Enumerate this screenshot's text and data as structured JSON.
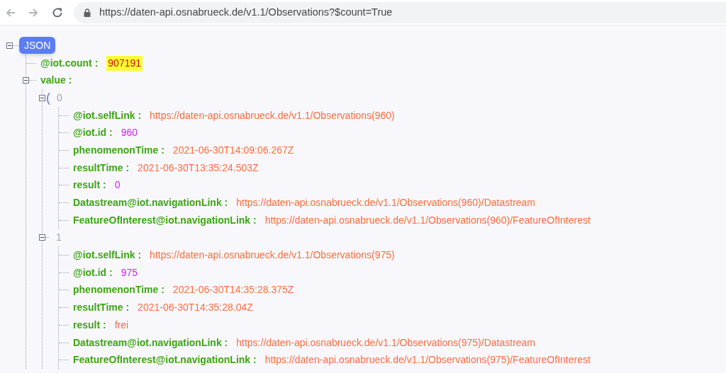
{
  "address_bar": {
    "url": "https://daten-api.osnabrueck.de/v1.1/Observations?$count=True"
  },
  "root": {
    "label": "JSON",
    "expanded": true,
    "count": {
      "key": "@iot.count :",
      "value": "907191",
      "highlighted": true
    },
    "value": {
      "key": "value :",
      "expanded": true,
      "items": [
        {
          "bracket": "(",
          "index": "0",
          "expanded": true,
          "fields": [
            {
              "key": "@iot.selfLink :",
              "value": "https://daten-api.osnabrueck.de/v1.1/Observations(960)",
              "kind": "string"
            },
            {
              "key": "@iot.id :",
              "value": "960",
              "kind": "number"
            },
            {
              "key": "phenomenonTime :",
              "value": "2021-06-30T14:09:06.267Z",
              "kind": "string"
            },
            {
              "key": "resultTime :",
              "value": "2021-06-30T13:35:24.503Z",
              "kind": "string"
            },
            {
              "key": "result :",
              "value": "0",
              "kind": "number"
            },
            {
              "key": "Datastream@iot.navigationLink :",
              "value": "https://daten-api.osnabrueck.de/v1.1/Observations(960)/Datastream",
              "kind": "string"
            },
            {
              "key": "FeatureOfInterest@iot.navigationLink :",
              "value": "https://daten-api.osnabrueck.de/v1.1/Observations(960)/FeatureOfInterest",
              "kind": "string"
            }
          ]
        },
        {
          "index": "1",
          "expanded": true,
          "fields": [
            {
              "key": "@iot.selfLink :",
              "value": "https://daten-api.osnabrueck.de/v1.1/Observations(975)",
              "kind": "string"
            },
            {
              "key": "@iot.id :",
              "value": "975",
              "kind": "number"
            },
            {
              "key": "phenomenonTime :",
              "value": "2021-06-30T14:35:28.375Z",
              "kind": "string"
            },
            {
              "key": "resultTime :",
              "value": "2021-06-30T14:35:28.04Z",
              "kind": "string"
            },
            {
              "key": "result :",
              "value": "frei",
              "kind": "string"
            },
            {
              "key": "Datastream@iot.navigationLink :",
              "value": "https://daten-api.osnabrueck.de/v1.1/Observations(975)/Datastream",
              "kind": "string"
            },
            {
              "key": "FeatureOfInterest@iot.navigationLink :",
              "value": "https://daten-api.osnabrueck.de/v1.1/Observations(975)/FeatureOfInterest",
              "kind": "string"
            }
          ]
        }
      ]
    }
  }
}
